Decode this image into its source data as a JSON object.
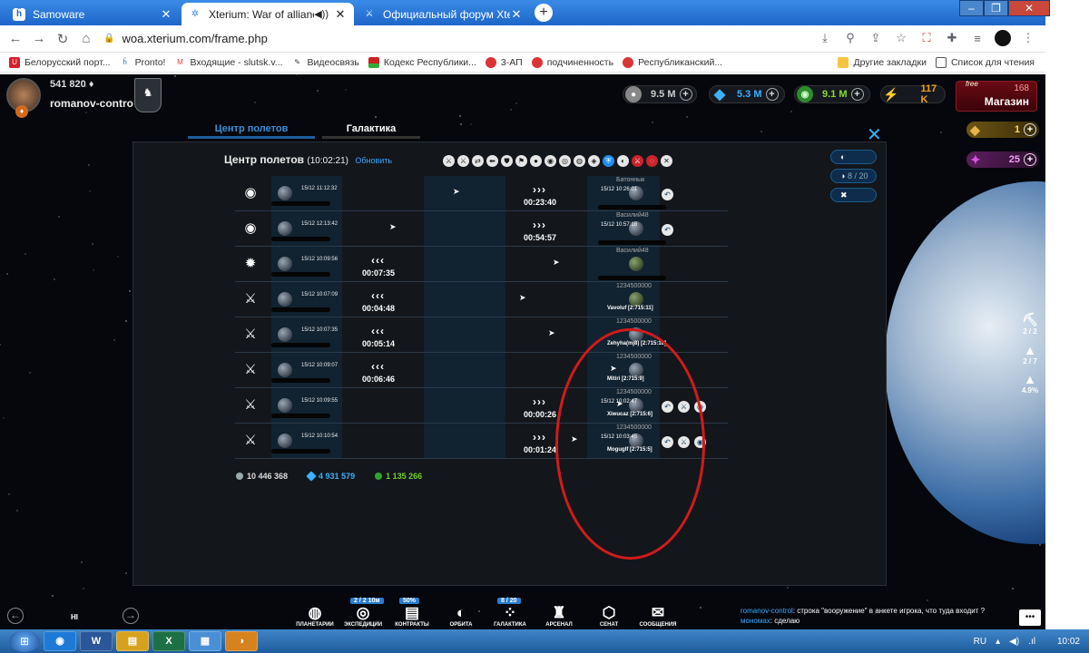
{
  "browser": {
    "tabs": [
      {
        "title": "Samoware",
        "icon": "samoware-icon"
      },
      {
        "title": "Xterium: War of alliances",
        "icon": "xterium-icon",
        "active": true
      },
      {
        "title": "Официальный форум Xterium",
        "icon": "forum-icon"
      }
    ],
    "new_tab": "+",
    "url": "woa.xterium.com/frame.php",
    "bookmarks": [
      "Белорусский порт...",
      "Pronto!",
      "Входящие - slutsk.v...",
      "Видеосвязь",
      "Кодекс Республики...",
      "3-АП",
      "подчиненность",
      "Республиканский..."
    ],
    "bookmarks_right": [
      "Другие закладки",
      "Список для чтения"
    ]
  },
  "game": {
    "player": {
      "score": "541 820",
      "name": "romanov-control"
    },
    "resources": [
      {
        "value": "9.5 M",
        "color": "#c9c9c9"
      },
      {
        "value": "5.3 M",
        "color": "#3ab1ff"
      },
      {
        "value": "9.1 M",
        "color": "#8bdc2d"
      },
      {
        "value": "117 K",
        "color": "#f0a020"
      }
    ],
    "shop": {
      "free": "free",
      "count": "168",
      "label": "Магазин"
    },
    "side_resources": [
      {
        "value": "1",
        "color": "#5a4310"
      },
      {
        "value": "25",
        "color": "#4d1c4f"
      }
    ],
    "tabs": [
      {
        "label": "Центр полетов",
        "active": true
      },
      {
        "label": "Галактика",
        "active": false
      }
    ],
    "close": "✕",
    "fleet_center": {
      "title": "Центр полетов",
      "time": "(10:02:21)",
      "refresh": "Обновить",
      "filters": [
        "⚔",
        "⚔",
        "⇄",
        "⬅",
        "⛊",
        "⚑",
        "●",
        "◉",
        "◎",
        "◍",
        "◈",
        "⛨",
        "◐",
        "⚔",
        "◌",
        "✕"
      ],
      "side_buttons": [
        "",
        "8 / 20",
        ""
      ],
      "rows": [
        {
          "mission": "◉",
          "start": "15/12 11:12:32",
          "direction": "›››",
          "timer": "00:23:40",
          "end": "15/12 10:26:01",
          "owner": "Батоннык",
          "coord": "",
          "green": false,
          "acts": [
            "↶"
          ]
        },
        {
          "mission": "◉",
          "start": "15/12 12:13:42",
          "direction": "›››",
          "timer": "00:54:57",
          "end": "15/12 10:57:18",
          "owner": "Василий48",
          "coord": "",
          "green": false,
          "acts": [
            "↶"
          ]
        },
        {
          "mission": "✹",
          "start": "15/12 10:09:56",
          "direction": "‹‹‹",
          "timer": "00:07:35",
          "end": "",
          "owner": "Василий48",
          "coord": "",
          "green": true,
          "acts": []
        },
        {
          "mission": "⚔",
          "start": "15/12 10:07:09",
          "direction": "‹‹‹",
          "timer": "00:04:48",
          "end": "",
          "owner": "1234500000",
          "coord": "Vavoluf [2:715:11]",
          "green": true,
          "acts": []
        },
        {
          "mission": "⚔",
          "start": "15/12 10:07:35",
          "direction": "‹‹‹",
          "timer": "00:05:14",
          "end": "",
          "owner": "1234500000",
          "coord": "Zehyha(mj8) [2:715:10]",
          "green": false,
          "acts": []
        },
        {
          "mission": "⚔",
          "start": "15/12 10:09:07",
          "direction": "‹‹‹",
          "timer": "00:06:46",
          "end": "",
          "owner": "1234500000",
          "coord": "Mitiri [2:715:9]",
          "green": false,
          "acts": []
        },
        {
          "mission": "⚔",
          "start": "15/12 10:09:55",
          "direction": "›››",
          "timer": "00:00:26",
          "end": "15/12 10:02:47",
          "owner": "1234500000",
          "coord": "Xiwucaz [2:715:6]",
          "green": false,
          "acts": [
            "↶",
            "⚔",
            "◉"
          ]
        },
        {
          "mission": "⚔",
          "start": "15/12 10:10:54",
          "direction": "›››",
          "timer": "00:01:24",
          "end": "15/12 10:03:45",
          "owner": "1234500000",
          "coord": "Moguglf [2:715:5]",
          "green": false,
          "acts": [
            "↶",
            "⚔",
            "◉"
          ]
        }
      ],
      "totals": [
        {
          "value": "10 446 368",
          "color": "#9aa"
        },
        {
          "value": "4 931 579",
          "color": "#3ab1ff"
        },
        {
          "value": "1 135 266",
          "color": "#6fd02a"
        }
      ]
    },
    "right_widgets": [
      {
        "value": "2 / 2",
        "icon": "⛏"
      },
      {
        "value": "2 / 7",
        "icon": "▲"
      },
      {
        "value": "4.9%",
        "icon": "▲"
      }
    ],
    "bottom": {
      "hi": "HI",
      "nav": [
        {
          "label": "ПЛАНЕТАРИИ",
          "icon": "◍",
          "badge": ""
        },
        {
          "label": "ЭКСПЕДИЦИИ",
          "icon": "◎",
          "badge": "2 / 2  10м"
        },
        {
          "label": "КОНТРАКТЫ",
          "icon": "▤",
          "badge": "50%"
        },
        {
          "label": "ОРБИТА",
          "icon": "◐",
          "badge": ""
        },
        {
          "label": "ГАЛАКТИКА",
          "icon": "⁘",
          "badge": "8 / 20"
        },
        {
          "label": "АРСЕНАЛ",
          "icon": "♜",
          "badge": ""
        },
        {
          "label": "СЕНАТ",
          "icon": "⬡",
          "badge": ""
        },
        {
          "label": "СООБЩЕНИЯ",
          "icon": "✉",
          "badge": ""
        }
      ],
      "chat": [
        {
          "user": "romanov-control",
          "text": ": строка \"вооружение\" в анкете игрока, что туда входит ?"
        },
        {
          "user": "мономах",
          "text": ": сделаю"
        }
      ]
    }
  },
  "taskbar": {
    "apps": [
      "◉",
      "W",
      "▤",
      "X",
      "▦",
      "◑"
    ],
    "lang": "RU",
    "time": "10:02"
  }
}
